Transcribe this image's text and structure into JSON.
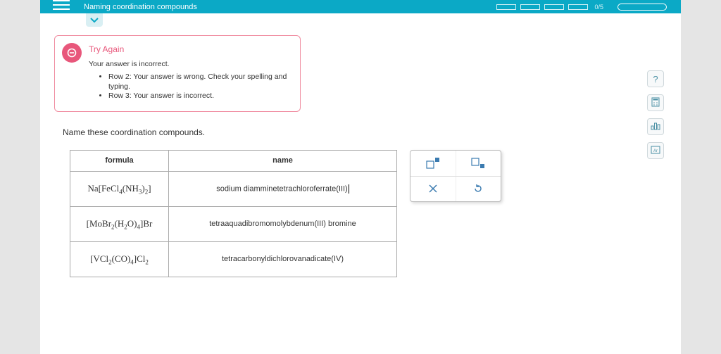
{
  "header": {
    "title": "Naming coordination compounds",
    "progress_label": "0/5"
  },
  "feedback": {
    "title": "Try Again",
    "subtitle": "Your answer is incorrect.",
    "bullets": [
      "Row 2: Your answer is wrong. Check your spelling and typing.",
      "Row 3: Your answer is incorrect."
    ]
  },
  "prompt": "Name these coordination compounds.",
  "table": {
    "headers": {
      "formula": "formula",
      "name": "name"
    },
    "rows": [
      {
        "formula_html": "Na[FeCl<sub>4</sub>(NH<sub>3</sub>)<sub>2</sub>]",
        "name": "sodium diamminetetrachloroferrate(III)",
        "show_cursor": true
      },
      {
        "formula_html": "[MoBr<sub>2</sub>(H<sub>2</sub>O)<sub>4</sub>]Br",
        "name": "tetraaquadibromomolybdenum(III) bromine",
        "show_cursor": false
      },
      {
        "formula_html": "[VCl<sub>2</sub>(CO)<sub>4</sub>]Cl<sub>2</sub>",
        "name": "tetracarbonyldichlorovanadicate(IV)",
        "show_cursor": false
      }
    ]
  }
}
